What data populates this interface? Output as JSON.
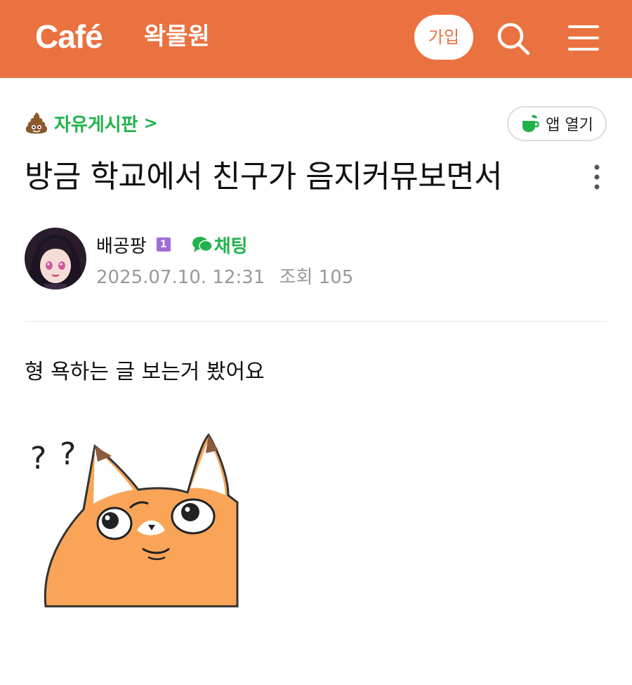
{
  "header": {
    "logo": "Café",
    "cafe_name": "왁물원",
    "join_label": "가입",
    "icons": [
      "search-icon",
      "menu-icon"
    ],
    "accent_color": "#EA7240"
  },
  "board": {
    "emoji": "poop-emoji",
    "name": "자유게시판",
    "chevron": ">",
    "color": "#22B24C"
  },
  "app_open": {
    "label": "앱 열기",
    "icon": "cup-icon"
  },
  "post": {
    "title": "방금 학교에서 친구가 음지커뮤보면서",
    "author": "배공팡",
    "level": "1",
    "chat_label": "채팅",
    "date": "2025.07.10. 12:31",
    "views": "조회 105",
    "body": "형 욕하는 글 보는거 봤어요",
    "sticker": "confused-orange-cat-sticker"
  }
}
